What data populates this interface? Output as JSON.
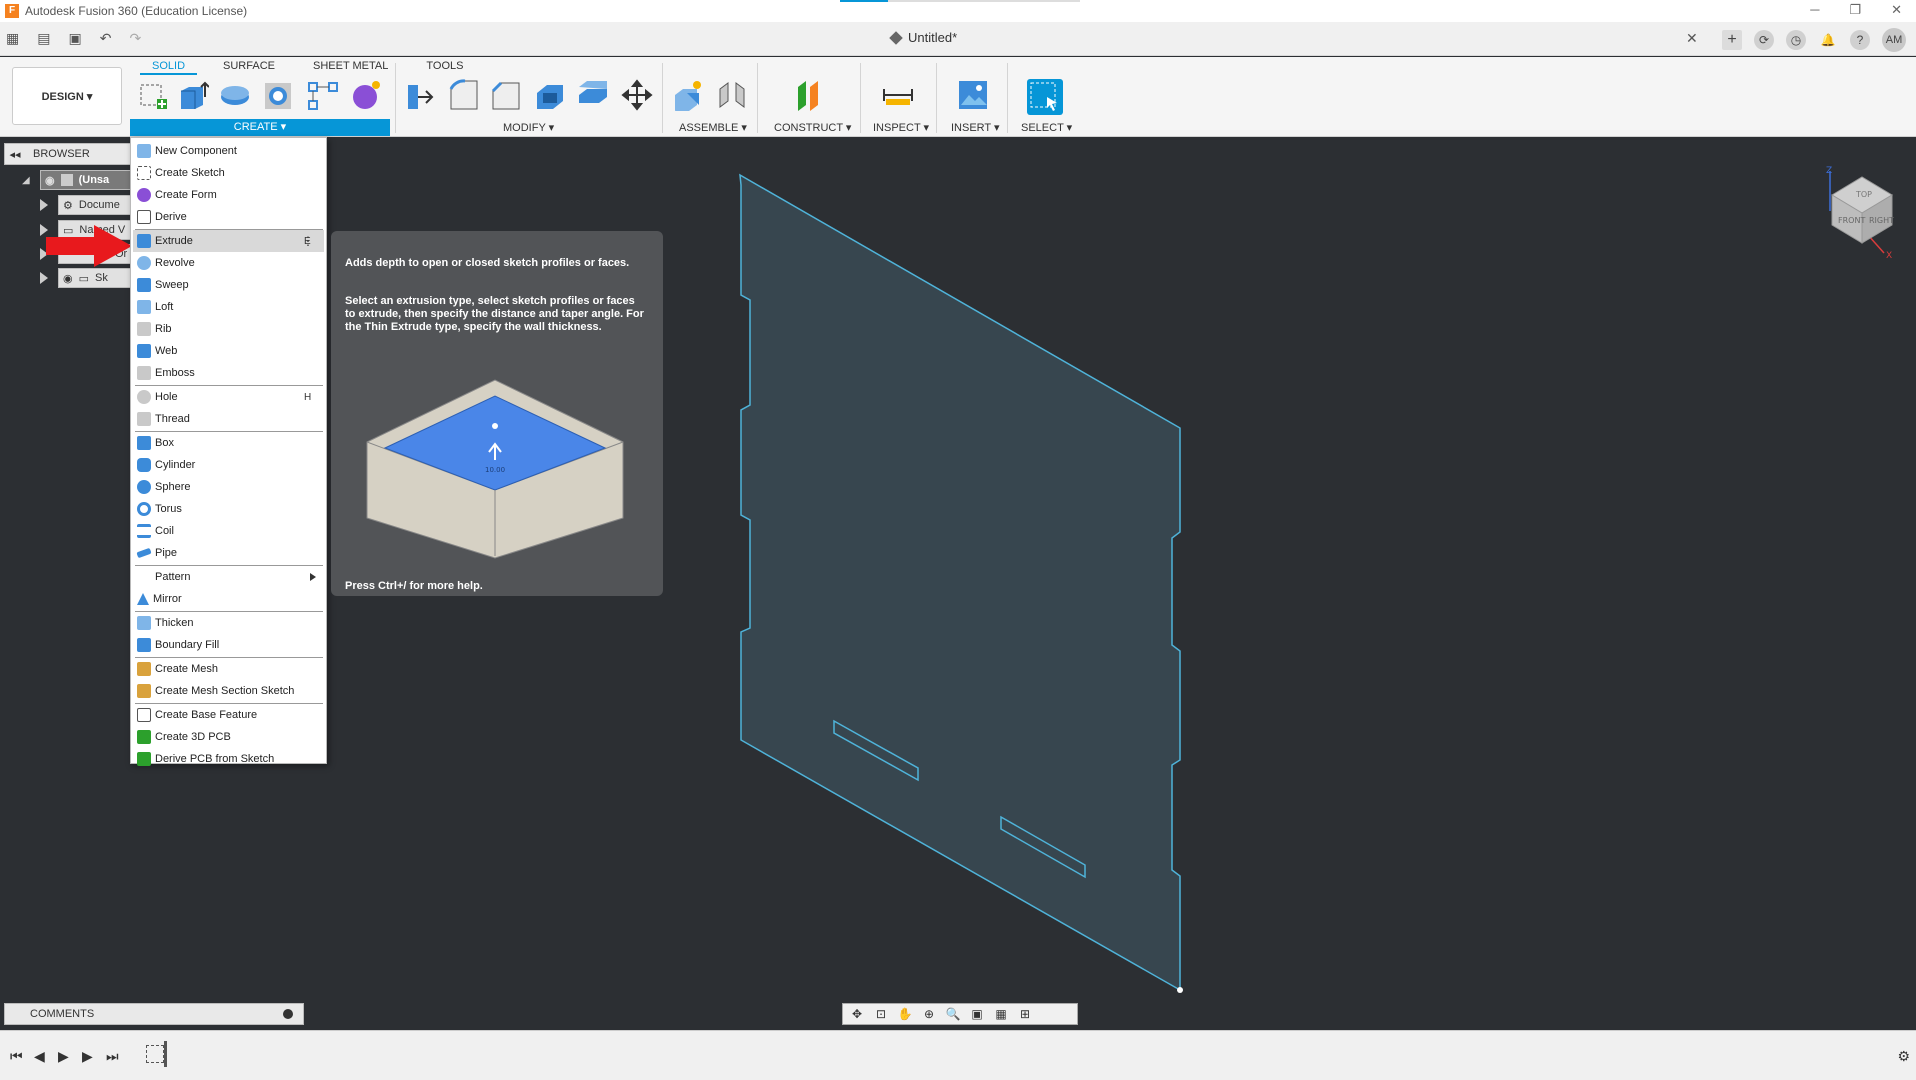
{
  "window": {
    "title": "Autodesk Fusion 360 (Education License)",
    "logo_letter": "F",
    "controls": [
      "─",
      "❐",
      "✕"
    ]
  },
  "tabbar": {
    "document_title": "Untitled*",
    "close": "✕",
    "avatar": "AM"
  },
  "ribbon": {
    "workspace_button": "DESIGN ▾",
    "tabs": [
      "SOLID",
      "SURFACE",
      "SHEET METAL",
      "TOOLS"
    ],
    "active_tab": "SOLID",
    "groups": {
      "create": "CREATE ▾",
      "modify": "MODIFY ▾",
      "assemble": "ASSEMBLE ▾",
      "construct": "CONSTRUCT ▾",
      "inspect": "INSPECT ▾",
      "insert": "INSERT ▾",
      "select": "SELECT ▾"
    }
  },
  "browser": {
    "header": "BROWSER",
    "rows": [
      "(Unsa",
      "Docume",
      "Named V",
      "Or",
      "Sk"
    ]
  },
  "create_menu": {
    "items": [
      {
        "label": "New Component",
        "key": ""
      },
      {
        "label": "Create Sketch",
        "key": ""
      },
      {
        "label": "Create Form",
        "key": ""
      },
      {
        "label": "Derive",
        "key": ""
      },
      {
        "label": "Extrude",
        "key": "E"
      },
      {
        "label": "Revolve",
        "key": ""
      },
      {
        "label": "Sweep",
        "key": ""
      },
      {
        "label": "Loft",
        "key": ""
      },
      {
        "label": "Rib",
        "key": ""
      },
      {
        "label": "Web",
        "key": ""
      },
      {
        "label": "Emboss",
        "key": ""
      },
      {
        "label": "Hole",
        "key": "H"
      },
      {
        "label": "Thread",
        "key": ""
      },
      {
        "label": "Box",
        "key": ""
      },
      {
        "label": "Cylinder",
        "key": ""
      },
      {
        "label": "Sphere",
        "key": ""
      },
      {
        "label": "Torus",
        "key": ""
      },
      {
        "label": "Coil",
        "key": ""
      },
      {
        "label": "Pipe",
        "key": ""
      },
      {
        "label": "Pattern",
        "key": ""
      },
      {
        "label": "Mirror",
        "key": ""
      },
      {
        "label": "Thicken",
        "key": ""
      },
      {
        "label": "Boundary Fill",
        "key": ""
      },
      {
        "label": "Create Mesh",
        "key": ""
      },
      {
        "label": "Create Mesh Section Sketch",
        "key": ""
      },
      {
        "label": "Create Base Feature",
        "key": ""
      },
      {
        "label": "Create 3D PCB",
        "key": ""
      },
      {
        "label": "Derive PCB from Sketch",
        "key": ""
      }
    ],
    "kebab": "⋮"
  },
  "tooltip": {
    "line1": "Adds depth to open or closed sketch profiles or faces.",
    "line2": "Select an extrusion type, select sketch profiles or faces to extrude, then specify the distance and taper angle. For the Thin Extrude type, specify the wall thickness.",
    "footer": "Press Ctrl+/ for more help.",
    "preview_value": "10.00"
  },
  "viewcube": {
    "top": "TOP",
    "front": "FRONT",
    "right": "RIGHT",
    "axis_z": "Z",
    "axis_x": "X"
  },
  "comments": {
    "label": "COMMENTS"
  },
  "colors": {
    "accent": "#0696d7",
    "viewport_bg": "#2c2f33",
    "sketch_line": "#4fb3d9",
    "sketch_fill": "#3a4a55",
    "arrow": "#e8191d",
    "tooltip_bg": "#525457"
  }
}
